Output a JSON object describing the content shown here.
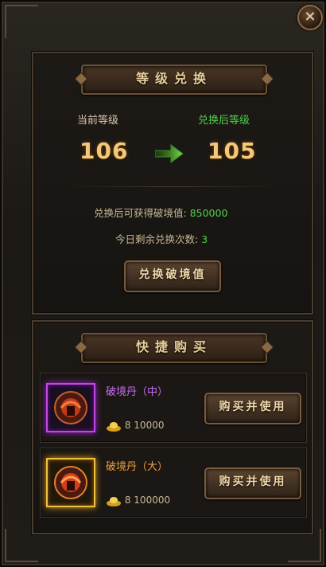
{
  "window": {
    "close_label": "×"
  },
  "level_exchange": {
    "title": "等级兑换",
    "current_level_label": "当前等级",
    "after_level_label": "兑换后等级",
    "current_level": "106",
    "after_level": "105",
    "reward_label": "兑换后可获得破境值:",
    "reward_value": "850000",
    "remaining_label": "今日剩余兑换次数:",
    "remaining_value": "3",
    "exchange_button": "兑换破境值"
  },
  "quick_buy": {
    "title": "快捷购买",
    "items": [
      {
        "name": "破境丹（中）",
        "currency_symbol": "8",
        "price": "10000",
        "button": "购买并使用",
        "name_color": "#c86ef0",
        "rarity": "purple"
      },
      {
        "name": "破境丹（大）",
        "currency_symbol": "8",
        "price": "100000",
        "button": "购买并使用",
        "name_color": "#f0a040",
        "rarity": "gold"
      }
    ]
  },
  "colors": {
    "current_level_label": "#d8c8a8",
    "after_level_label": "#4fd04a",
    "reward_value": "#4fd04a"
  }
}
